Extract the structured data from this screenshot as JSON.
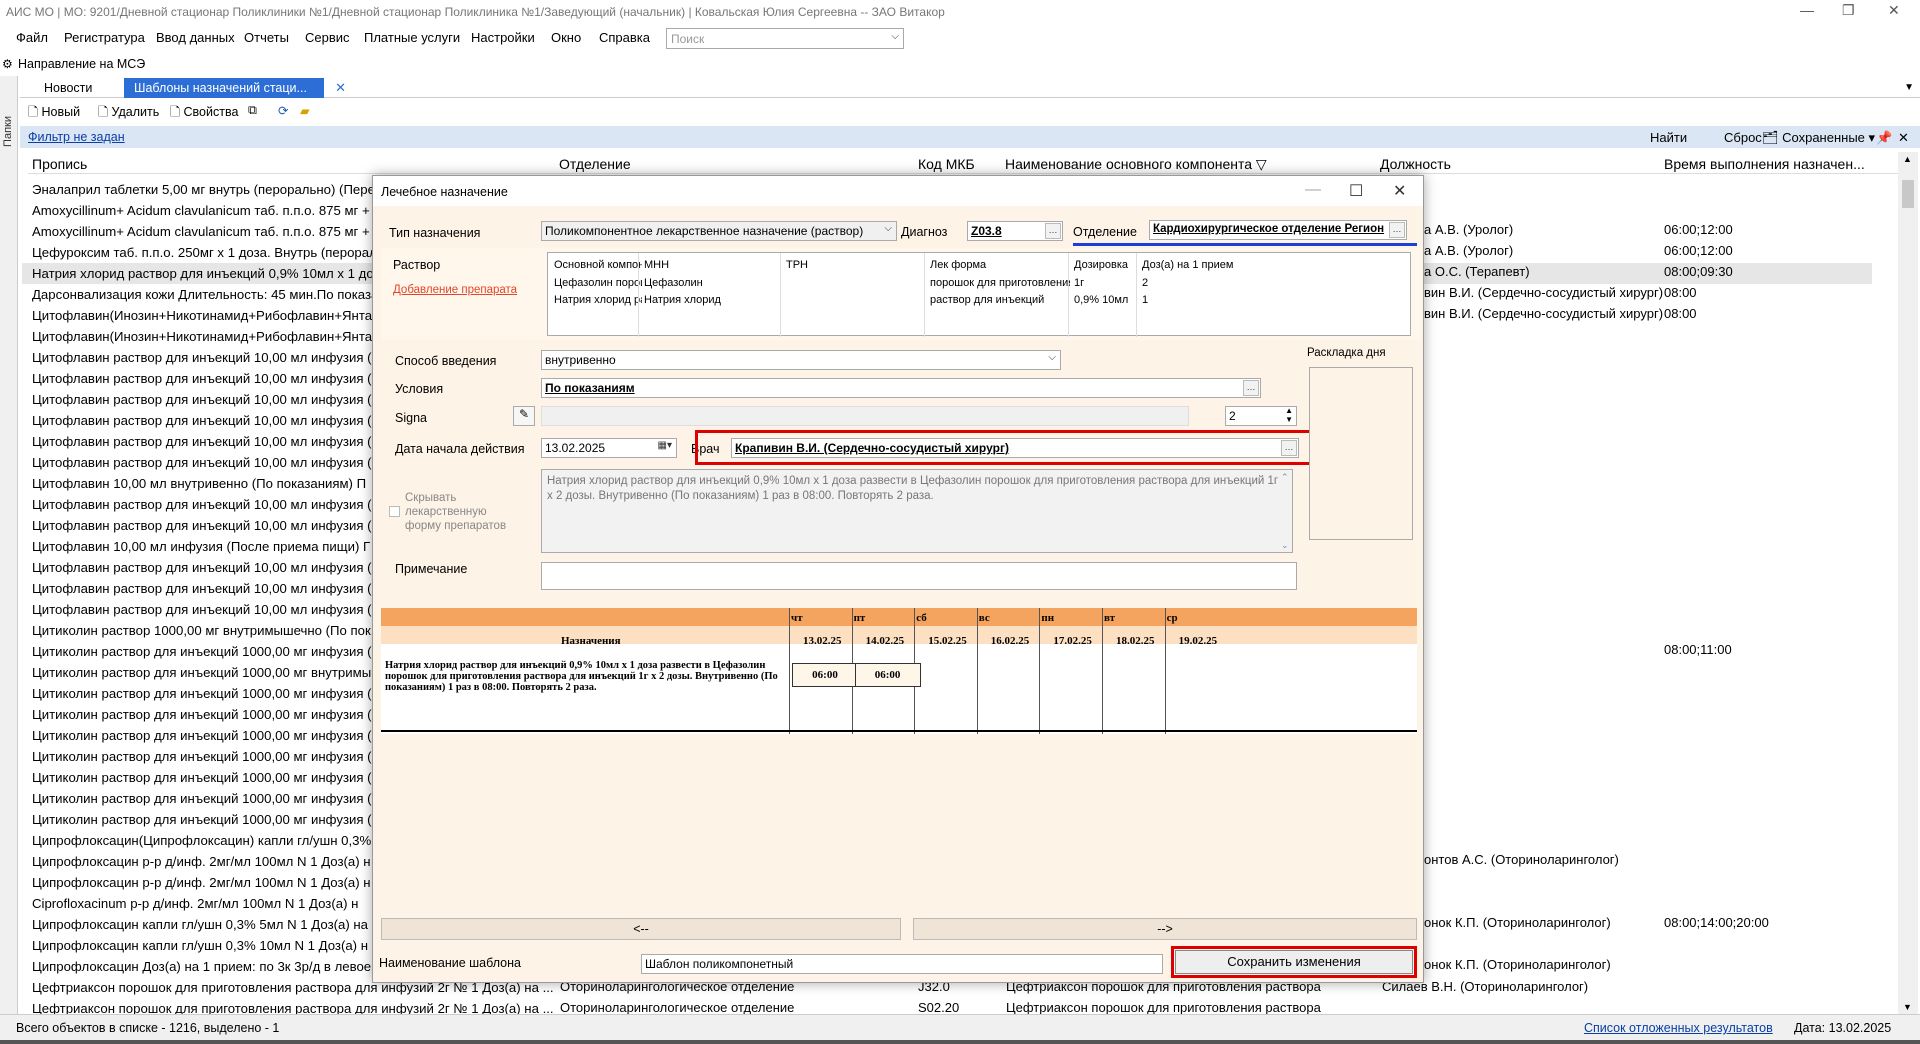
{
  "window": {
    "title": "АИС МО | МО: 9201/Дневной стационар Поликлиники №1/Дневной стационар Поликлиника №1/Заведующий (начальник) | Ковальская Юлия Сергеевна -- ЗАО Витакор",
    "min_glyph": "—",
    "max_glyph": "❐",
    "close_glyph": "✕"
  },
  "menu": [
    "Файл",
    "Регистратура",
    "Ввод данных",
    "Отчеты",
    "Сервис",
    "Платные услуги",
    "Настройки",
    "Окно",
    "Справка"
  ],
  "search": {
    "placeholder": "Поиск"
  },
  "form_title": "Направление на МСЭ",
  "side_label": "Папки",
  "tabs": [
    {
      "label": "Новости"
    },
    {
      "label": "Шаблоны назначений стаци..."
    }
  ],
  "toolbar": {
    "new": "Новый",
    "delete": "Удалить",
    "props": "Свойства"
  },
  "filter": {
    "text": "Фильтр не задан",
    "find": "Найти",
    "reset": "Сброс",
    "saved": "Сохраненные"
  },
  "grid": {
    "headers": [
      "Пропись",
      "Отделение",
      "Код МКБ",
      "Наименование основного компонента",
      "Должность",
      "Время выполнения назначен..."
    ],
    "rows": [
      "Эналаприл таблетки 5,00 мг  внутрь (перорально) (Пере",
      "Amoxycillinum+ Acidum clavulanicum таб. п.п.о. 875 мг +",
      "Amoxycillinum+ Acidum clavulanicum таб. п.п.о. 875 мг +",
      "Цефуроксим таб. п.п.о. 250мг х 1 доза. Внутрь (перорал",
      "Натрия хлорид раствор для инъекций 0,9% 10мл х 1 доз",
      "Дарсонвализация кожи Длительность: 45 мин.По показа",
      "Цитофлавин(Инозин+Никотинамид+Рибофлавин+Янтар",
      "Цитофлавин(Инозин+Никотинамид+Рибофлавин+Янтар",
      "Цитофлавин раствор для инъекций 10,00 мл  инфузия (П",
      "Цитофлавин раствор для инъекций 10,00 мл  инфузия (П",
      "Цитофлавин раствор для инъекций 10,00 мл  инфузия (П",
      "Цитофлавин раствор для инъекций 10,00 мл  инфузия (П",
      "Цитофлавин раствор для инъекций 10,00 мл  инфузия (П",
      "Цитофлавин раствор для инъекций 10,00 мл  инфузия (П",
      "Цитофлавин 10,00 мл  внутривенно (По показаниям)   П",
      "Цитофлавин раствор для инъекций 10,00 мл  инфузия (П",
      "Цитофлавин раствор для инъекций 10,00 мл  инфузия (П",
      "Цитофлавин 10,00 мл  инфузия (После приема пищи)   Г",
      "Цитофлавин раствор для инъекций 10,00 мл  инфузия (П",
      "Цитофлавин раствор для инъекций 10,00 мл  инфузия (П",
      "Цитофлавин раствор для инъекций 10,00 мл  инфузия (П",
      "Цитиколин раствор 1000,00 мг  внутримышечно (По пок",
      "Цитиколин раствор для инъекций 1000,00 мг  инфузия (П",
      "Цитиколин раствор для инъекций 1000,00 мг  внутримыш",
      "Цитиколин раствор для инъекций 1000,00 мг  инфузия (П",
      "Цитиколин раствор для инъекций 1000,00 мг  инфузия (П",
      "Цитиколин раствор для инъекций 1000,00 мг  инфузия (П",
      "Цитиколин раствор для инъекций 1000,00 мг  инфузия (П",
      "Цитиколин раствор для инъекций 1000,00 мг  инфузия (П",
      "Цитиколин раствор для инъекций 1000,00 мг  инфузия (П",
      "Цитиколин раствор для инъекций 1000,00 мг  инфузия (П",
      "Ципрофлоксацин(Ципрофлоксацин) капли гл/ушн 0,3% 5",
      "Ципрофлоксацин р-р д/инф. 2мг/мл 100мл N 1 Доз(а) н",
      "Ципрофлоксацин р-р д/инф. 2мг/мл 100мл N 1 Доз(а) н",
      "Ciprofloxacinum р-р д/инф. 2мг/мл 100мл N 1 Доз(а) н",
      "Ципрофлоксацин капли гл/ушн 0,3% 5мл N 1 Доз(а) на",
      "Ципрофлоксацин капли гл/ушн 0,3% 10мл N 1 Доз(а) н",
      "Ципрофлоксацин Доз(а) на 1 прием: по 3к 3р/д в левое",
      "Цефтриаксон порошок для приготовления раствора для инфузий 2г № 1 Доз(а) на ...",
      "Цефтриаксон порошок для приготовления раствора для инфузий 2г № 1 Доз(а) на ..."
    ],
    "right": [
      {
        "row": 1,
        "pos": "а А.В. (Уролог)",
        "time": "06:00;12:00"
      },
      {
        "row": 2,
        "pos": "а А.В. (Уролог)",
        "time": "06:00;12:00"
      },
      {
        "row": 3,
        "pos": "а О.С. (Терапевт)",
        "time": "08:00;09:30"
      },
      {
        "row": 4,
        "pos": "вин В.И. (Сердечно-сосудистый хирург)",
        "time": "08:00"
      },
      {
        "row": 5,
        "pos": "вин В.И. (Сердечно-сосудистый хирург)",
        "time": "08:00"
      },
      {
        "row": 21,
        "pos": "",
        "time": "08:00;11:00"
      },
      {
        "row": 31,
        "pos": "онтов А.С. (Оториноларинголог)",
        "time": ""
      },
      {
        "row": 34,
        "pos": "онок К.П. (Оториноларинголог)",
        "time": "08:00;14:00;20:00"
      },
      {
        "row": 36,
        "pos": "онок К.П. (Оториноларинголог)",
        "time": ""
      }
    ],
    "last_rows": [
      {
        "dept": "Оториноларингологическое отделение",
        "mkb": "J32.0",
        "comp": "Цефтриаксон порошок для приготовления раствора",
        "pos": "Силаев В.Н. (Оториноларинголог)"
      },
      {
        "dept": "Оториноларингологическое отделение",
        "mkb": "S02.20",
        "comp": "Цефтриаксон порошок для приготовления раствора",
        "pos": ""
      }
    ]
  },
  "status": {
    "count": "Всего объектов в списке - 1216, выделено - 1",
    "deferred": "Список отложенных результатов",
    "date": "Дата: 13.02.2025"
  },
  "dialog": {
    "title": "Лечебное назначение",
    "type_label": "Тип назначения",
    "type_value": "Поликомпонентное лекарственное назначение (раствор)",
    "diag_label": "Диагноз",
    "diag_value": "Z03.8",
    "dept_label": "Отделение",
    "dept_value": "Кардиохирургическое отделение Регион",
    "solution_label": "Раствор",
    "add_drug": "Добавление препарата",
    "sub_headers": [
      "Основной компон...",
      "МНН",
      "ТРН",
      "Лек форма",
      "Дозировка",
      "Доз(а) на 1 прием"
    ],
    "sub_rows": [
      [
        "Цефазолин порош...",
        "Цефазолин",
        "",
        "порошок для приготовления ...",
        "1г",
        "2"
      ],
      [
        "Натрия хлорид ра...",
        "Натрия хлорид",
        "",
        "раствор для инъекций",
        "0,9% 10мл",
        "1"
      ]
    ],
    "route_label": "Способ введения",
    "route_value": "внутривенно",
    "cond_label": "Условия",
    "cond_value": "По показаниям",
    "signa_label": "Signa",
    "signa_count": "2",
    "start_label": "Дата начала действия",
    "start_value": "13.02.2025",
    "doctor_label": "Врач",
    "doctor_value": "Крапивин В.И. (Сердечно-сосудистый хирург)",
    "hide_form_label": "Скрывать лекарственную форму препаратов",
    "preview": "Натрия хлорид раствор для инъекций 0,9% 10мл х 1 доза развести в Цефазолин порошок для приготовления раствора для инъекций 1г х 2 дозы. Внутривенно (По показаниям) 1 раз в 08:00. Повторять 2 раза.",
    "note_label": "Примечание",
    "day_plan_label": "Раскладка дня",
    "schedule": {
      "col_title": "Назначения",
      "days": [
        "чт",
        "пт",
        "сб",
        "вс",
        "пн",
        "вт",
        "ср"
      ],
      "dates": [
        "13.02.25",
        "14.02.25",
        "15.02.25",
        "16.02.25",
        "17.02.25",
        "18.02.25",
        "19.02.25"
      ],
      "row_text": "Натрия хлорид раствор для инъекций 0,9% 10мл х 1 доза развести в Цефазолин порошок для приготовления раствора для инъекций 1г х 2 дозы. Внутривенно (По показаниям) 1 раз в 08:00. Повторять 2 раза.",
      "slots": [
        "06:00",
        "06:00"
      ]
    },
    "prev_btn": "<--",
    "next_btn": "-->",
    "template_label": "Наименование шаблона",
    "template_value": "Шаблон поликомпонетный",
    "save_btn": "Сохранить изменения"
  }
}
